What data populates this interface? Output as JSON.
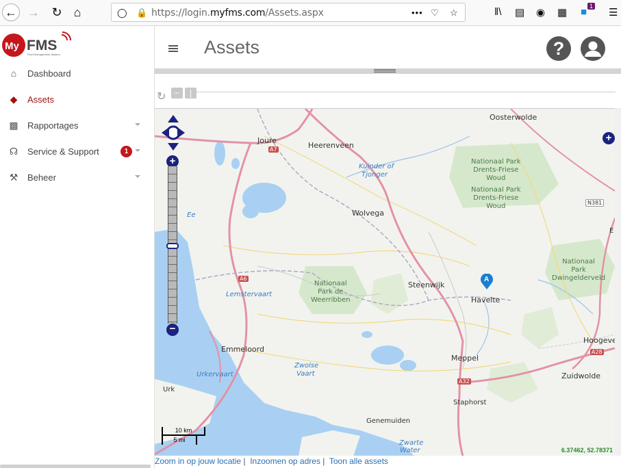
{
  "browser": {
    "url_prefix": "https://login.",
    "url_domain": "myfms.com",
    "url_path": "/Assets.aspx",
    "badge_count": "1"
  },
  "app": {
    "logo_text_my": "My",
    "logo_text_fms": "FMS",
    "logo_tagline": "Fleet Management System"
  },
  "sidebar": {
    "items": [
      {
        "label": "Dashboard",
        "icon": "home-icon"
      },
      {
        "label": "Assets",
        "icon": "layers-icon"
      },
      {
        "label": "Rapportages",
        "icon": "bar-chart-icon"
      },
      {
        "label": "Service & Support",
        "icon": "headset-icon",
        "badge": "1"
      },
      {
        "label": "Beheer",
        "icon": "wrench-icon"
      }
    ]
  },
  "header": {
    "title": "Assets",
    "help": "?"
  },
  "map": {
    "labels": {
      "joure": "Joure",
      "heerenveen": "Heerenveen",
      "oosterwolde": "Oosterwolde",
      "kuinder": "Kuinder of",
      "tjonger": "Tjonger",
      "wolvega": "Wolvega",
      "ee": "Ee",
      "steenwijk": "Steenwijk",
      "havelte": "Havelte",
      "lemstervaart": "Lemstervaart",
      "emmeloord": "Emmeloord",
      "meppel": "Meppel",
      "hoogeveen": "Hoogeve",
      "zuidwolde": "Zuidwolde",
      "urkervaart": "Urkervaart",
      "zwolse1": "Zwolse",
      "zwolse2": "Vaart",
      "urk": "Urk",
      "staphorst": "Staphorst",
      "genemuiden": "Genemuiden",
      "zwarte1": "Zwarte",
      "zwarte2": "Water",
      "park1": "Nationaal Park\nDrents-Friese\nWoud",
      "park2": "Nationaal Park\nDrents-Friese\nWoud",
      "park3": "Nationaal\nPark\nDwingelderveld",
      "park4": "Nationaal\nPark de\nWeerribben",
      "a7": "A7",
      "a6": "A6",
      "a32": "A32",
      "a28": "A28",
      "n381": "N381",
      "e_edge": "E"
    },
    "marker_label": "A",
    "scale_km": "10 km",
    "scale_mi": "5 mi",
    "coords": "6.37462, 52.78371"
  },
  "footer": {
    "link1": "Zoom in op jouw locatie",
    "link2": "Inzoomen op adres",
    "link3": "Toon alle assets",
    "sep": "|"
  }
}
